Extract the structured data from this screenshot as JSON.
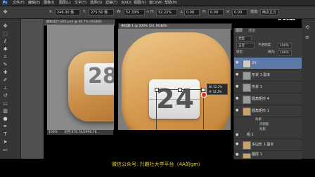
{
  "app": {
    "logo_text": "Ps"
  },
  "menubar": {
    "items": [
      "文件(F)",
      "编辑(E)",
      "图像(I)",
      "图层(L)",
      "文字(Y)",
      "选择(S)",
      "滤镜(T)",
      "3D(D)",
      "视图(V)",
      "窗口(W)",
      "帮助(H)"
    ]
  },
  "options": {
    "x_label": "X:",
    "x_value": "246.00 像",
    "y_label": "Y:",
    "y_value": "275.50 像",
    "w_label": "W:",
    "w_value": "52.33%",
    "h_label": "H:",
    "h_value": "52.22%",
    "angle_value": "0.00",
    "hskew_label": "H:",
    "hskew_value": "0.00",
    "vskew_label": "V:",
    "vskew_value": "0.00",
    "interp_label": "插值:",
    "interp_value": "两次立方"
  },
  "watermark": {
    "text": "优酷"
  },
  "doc1": {
    "tab_title": "图标设计-日历.psd @ 66.7% (RGB/8)",
    "zoom": "100%",
    "doc_size": "文档:376.7K/2996.7K",
    "number": "28"
  },
  "doc2": {
    "tab_title": "未标题-1 @ 200% (24, RGB/8)",
    "number": "24",
    "transform_readout": {
      "w": "W: 52.2%",
      "h": "H: 52.2%"
    }
  },
  "layers": {
    "tabs": [
      "图层",
      "通道"
    ],
    "mode_label": "正常",
    "opacity_label": "不透明度:",
    "opacity_value": "100%",
    "fill_label": "填充:",
    "fill_value": "100%",
    "lock_label": "锁定:",
    "kind_label": "类型",
    "rows": [
      {
        "name": "24"
      },
      {
        "name": "形状 1 副本"
      },
      {
        "name": "形状 1"
      },
      {
        "name": "圆角矩形 4"
      },
      {
        "name": "圆角矩形 1"
      },
      {
        "name": "效果"
      },
      {
        "name": "内阴影"
      },
      {
        "name": "投影"
      },
      {
        "name": "组 1"
      },
      {
        "name": "多边形 1 副本"
      },
      {
        "name": "图层 1"
      },
      {
        "name": "效果"
      },
      {
        "name": "内阴影"
      }
    ]
  },
  "right_panel_labels": {
    "a": "a",
    "b": "b",
    "c": "c"
  },
  "caption": {
    "text": "微信公众号: 兴趣社大学平台（4A的gm）"
  }
}
